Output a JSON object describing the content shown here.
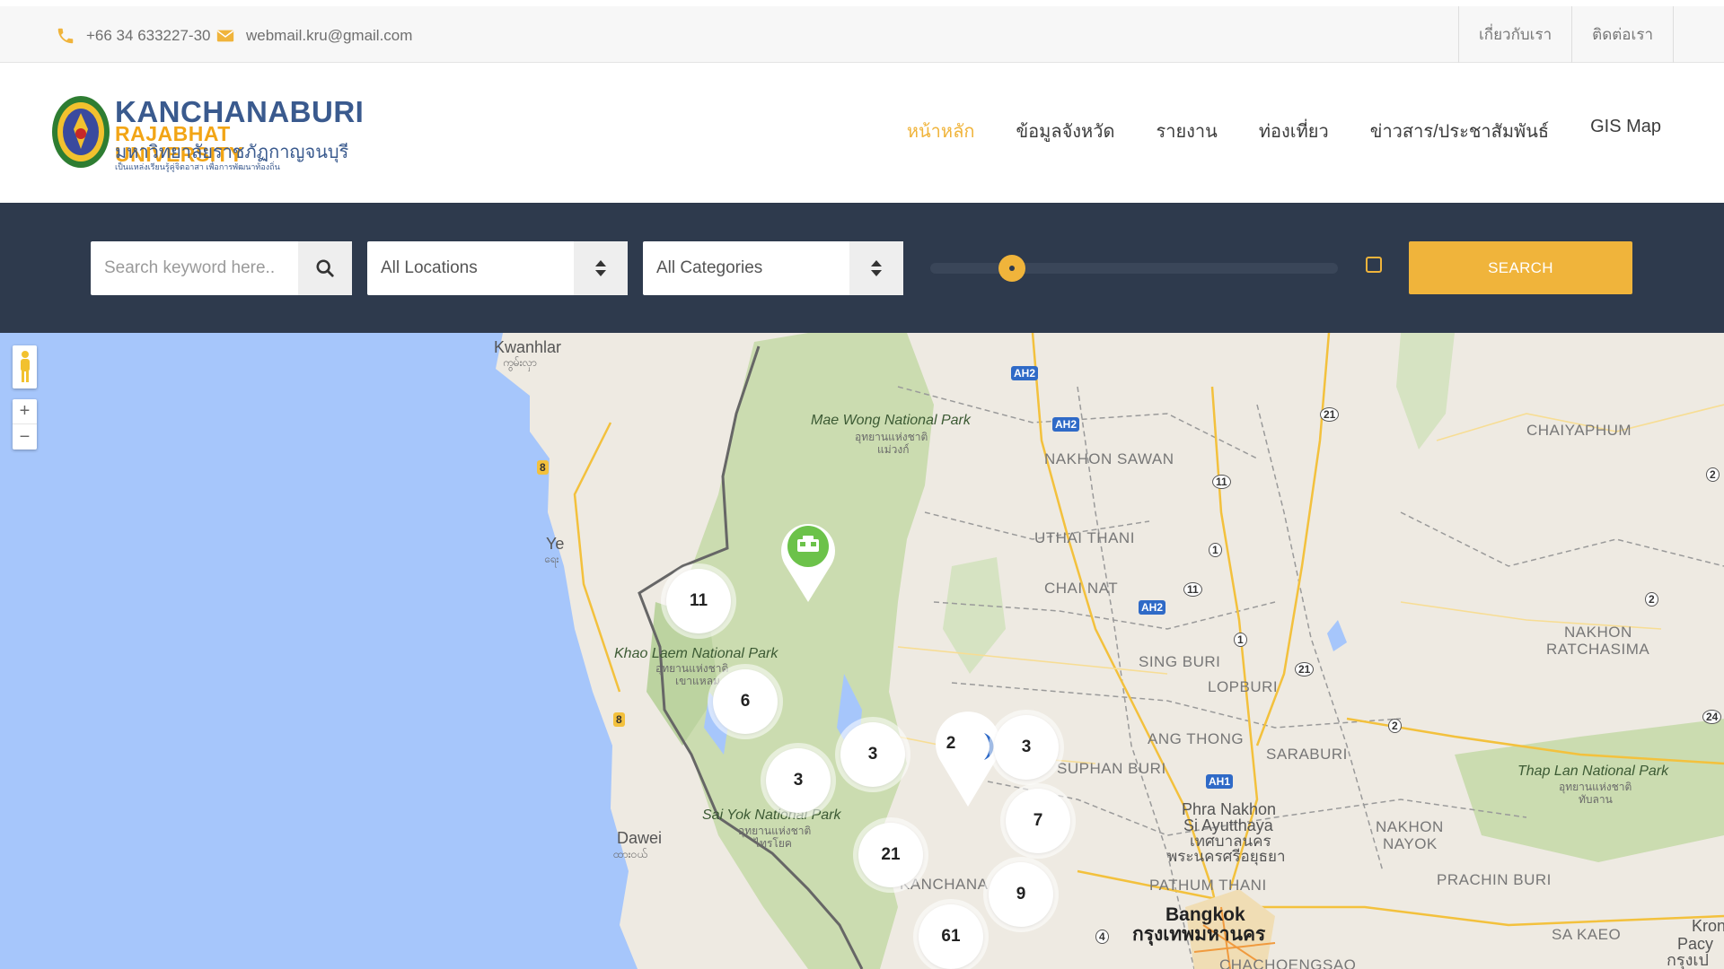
{
  "topbar": {
    "phone": "+66 34 633227-30",
    "email": "webmail.kru@gmail.com",
    "links": [
      "เกี่ยวกับเรา",
      "ติดต่อเรา"
    ]
  },
  "logo": {
    "line1": "KANCHANABURI",
    "line2": "RAJABHAT UNIVERSITY",
    "line3": "มหาวิทยาลัยราชภัฏกาญจนบุรี",
    "line4": "เป็นแหล่งเรียนรู้คู่จิตอาสา เพื่อการพัฒนาท้องถิ่น"
  },
  "nav": {
    "items": [
      "หน้าหลัก",
      "ข้อมูลจังหวัด",
      "รายงาน",
      "ท่องเที่ยว",
      "ข่าวสาร/ประชาสัมพันธ์",
      "GIS Map"
    ],
    "active_index": 0
  },
  "search": {
    "keyword_placeholder": "Search keyword here..",
    "location_value": "All Locations",
    "category_value": "All Categories",
    "radius_slider_fraction": 0.2,
    "button_label": "SEARCH"
  },
  "colors": {
    "accent": "#f0b43b",
    "bar_bg": "#2e3a4d",
    "sea": "#a6c6fb",
    "forest": "#cbdcb0"
  },
  "map": {
    "zoom_in": "+",
    "zoom_out": "−",
    "pegman_icon": "pegman-icon",
    "clusters": [
      "11",
      "6",
      "3",
      "3",
      "2",
      "3",
      "7",
      "21",
      "9",
      "61"
    ],
    "labels": {
      "kwanhlar": "Kwanhlar",
      "kwanhlar_mm": "ကွမ်းလှာ",
      "ye": "Ye",
      "ye_mm": "ရေး",
      "dawei": "Dawei",
      "dawei_mm": "ထားဝယ်",
      "mae_wong": "Mae Wong National Park",
      "mae_wong_th": "อุทยานแห่งชาติ",
      "mae_wong_th2": "แม่วงก์",
      "khao_laem": "Khao Laem National Park",
      "khao_laem_th": "อุทยานแห่งชาติ",
      "khao_laem_th2": "เขาแหลม",
      "sai_yok": "Sai Yok National Park",
      "sai_yok_th": "อุทยานแห่งชาติ",
      "sai_yok_th2": "ไทรโยค",
      "thap_lan": "Thap Lan National Park",
      "thap_lan_th": "อุทยานแห่งชาติ",
      "thap_lan_th2": "ทับลาน",
      "nakhon_sawan": "NAKHON SAWAN",
      "uthai_thani": "UTHAI THANI",
      "chai_nat": "CHAI NAT",
      "sing_buri": "SING BURI",
      "lopburi": "LOPBURI",
      "ang_thong": "ANG THONG",
      "saraburi": "SARABURI",
      "suphan_buri": "SUPHAN BURI",
      "kanchanaburi": "KANCHANA",
      "pathum_thani": "PATHUM THANI",
      "phra_nakhon": "Phra Nakhon",
      "si_ayutthaya": "Si Ayutthaya",
      "ayutthaya_th": "เทศบาลนคร",
      "ayutthaya_th2": "พระนครศรีอยุธยา",
      "bangkok": "Bangkok",
      "bangkok_th": "กรุงเทพมหานคร",
      "nakhon_nayok": "NAKHON",
      "nakhon_nayok2": "NAYOK",
      "prachin_buri": "PRACHIN BURI",
      "chaiyaphum": "CHAIYAPHUM",
      "nakhon_ratchasima": "NAKHON",
      "nakhon_ratchasima2": "RATCHASIMA",
      "sa_kaeo": "SA KAEO",
      "chachoengsao": "CHACHOENGSAO",
      "krong": "Kron",
      "pacy": "Pacy",
      "kron_th": "กรุงเป"
    },
    "routes": [
      "AH2",
      "AH2",
      "AH2",
      "AH1",
      "21",
      "11",
      "1",
      "11",
      "1",
      "21",
      "2",
      "2",
      "24",
      "2",
      "8",
      "8",
      "4"
    ]
  }
}
